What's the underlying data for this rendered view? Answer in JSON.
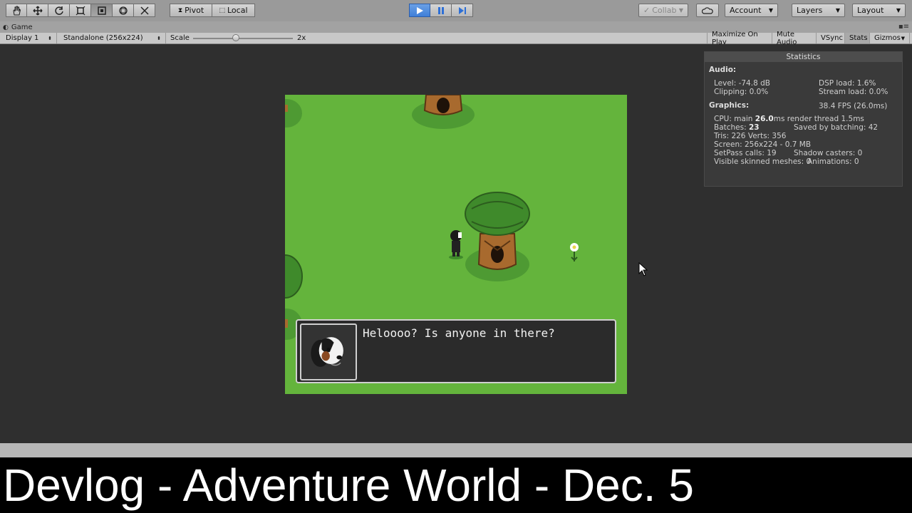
{
  "toolbar": {
    "pivot_label": "Pivot",
    "local_label": "Local",
    "collab_label": "Collab",
    "account_label": "Account",
    "layers_label": "Layers",
    "layout_label": "Layout"
  },
  "tab": {
    "title": "Game"
  },
  "gamebar": {
    "display": "Display 1",
    "resolution": "Standalone (256x224)",
    "scale_label": "Scale",
    "scale_value": "2x",
    "maximize": "Maximize On Play",
    "mute": "Mute Audio",
    "vsync": "VSync",
    "stats": "Stats",
    "gizmos": "Gizmos"
  },
  "stats": {
    "title": "Statistics",
    "audio_header": "Audio:",
    "level": "Level: -74.8 dB",
    "clipping": "Clipping: 0.0%",
    "dsp": "DSP load: 1.6%",
    "stream": "Stream load: 0.0%",
    "graphics_header": "Graphics:",
    "fps": "38.4 FPS (26.0ms)",
    "cpu_prefix": "CPU: main ",
    "cpu_main": "26.0",
    "cpu_suffix": "ms  render thread 1.5ms",
    "batches_prefix": "Batches: ",
    "batches": "23",
    "saved": "Saved by batching: 42",
    "tris": "Tris: 226  Verts: 356",
    "screen": "Screen: 256x224 - 0.7 MB",
    "setpass": "SetPass calls: 19",
    "shadow": "Shadow casters: 0",
    "skinned": "Visible skinned meshes: 0",
    "animations": "Animations: 0"
  },
  "game": {
    "dialog_text": "Heloooo? Is anyone in there?"
  },
  "caption": "Devlog - Adventure World - Dec. 5",
  "colors": {
    "grass": "#64b43c",
    "tree_dark": "#3f8a2b",
    "trunk": "#a86a2e",
    "play_blue": "#3f7fd8"
  }
}
